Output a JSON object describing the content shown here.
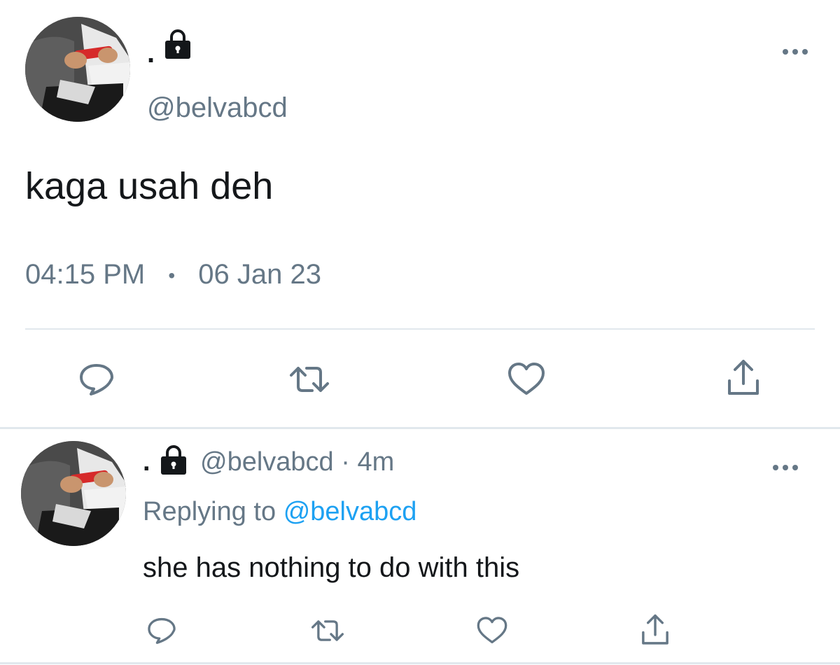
{
  "colors": {
    "text": "#14171a",
    "muted": "#657786",
    "link": "#1da1f2",
    "divider": "#e1e8ed"
  },
  "main_tweet": {
    "display_name": ".",
    "handle": "@belvabcd",
    "text": "kaga usah deh",
    "time": "04:15 PM",
    "separator": "•",
    "date": "06 Jan 23",
    "icons": [
      "avatar",
      "lock-icon",
      "more-icon",
      "reply-icon",
      "retweet-icon",
      "like-icon",
      "share-icon"
    ]
  },
  "reply_tweet": {
    "display_name": ".",
    "handle": "@belvabcd",
    "meta_sep": "·",
    "age": "4m",
    "replying_prefix": "Replying to",
    "replying_handle": "@belvabcd",
    "text": "she has nothing to do with this",
    "icons": [
      "avatar",
      "lock-icon",
      "more-icon",
      "reply-icon",
      "retweet-icon",
      "like-icon",
      "share-icon"
    ]
  }
}
